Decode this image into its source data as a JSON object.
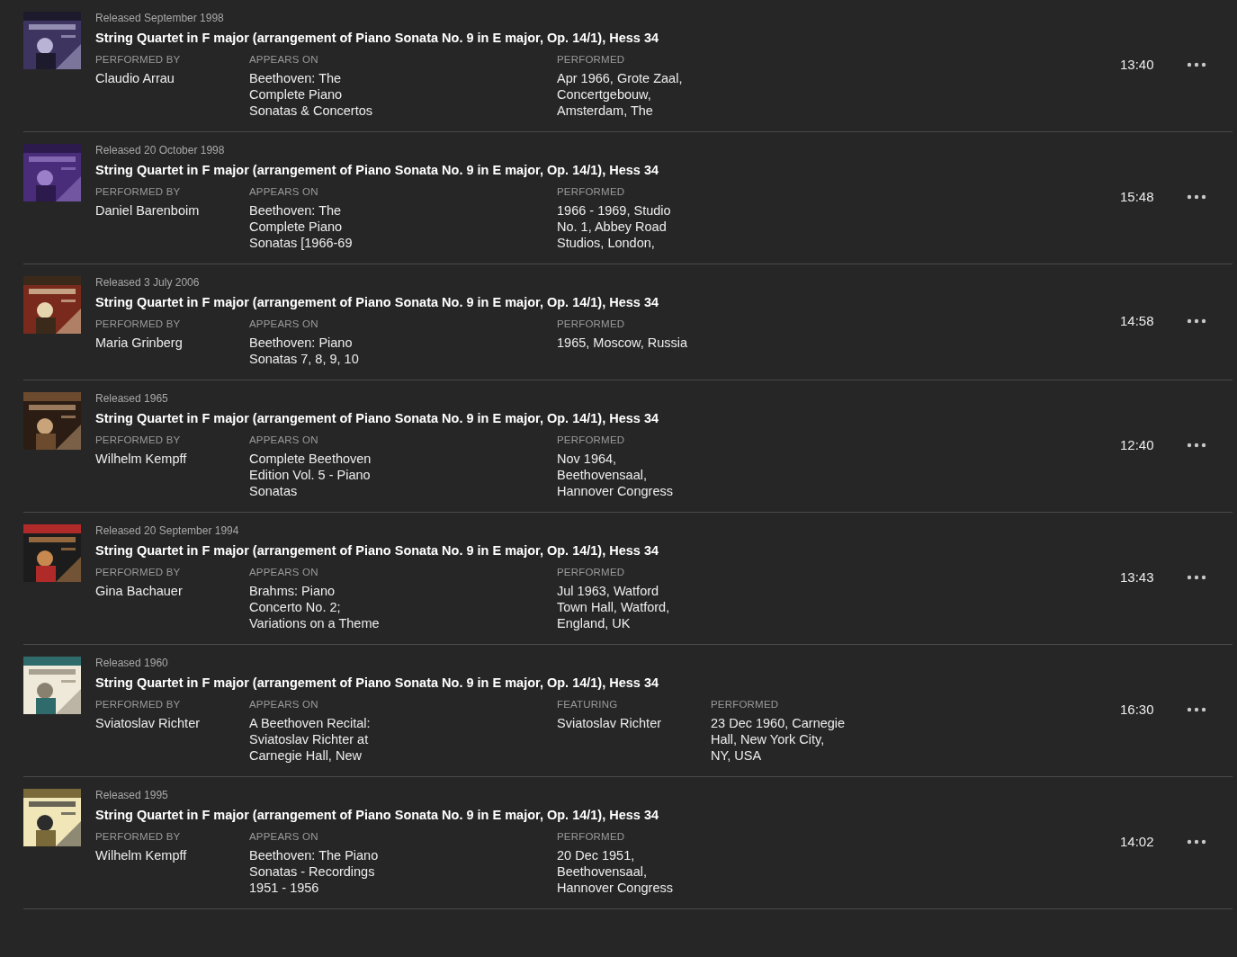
{
  "recordings": [
    {
      "released": "Released September 1998",
      "title": "String Quartet in F major (arrangement of Piano Sonata No. 9 in E major, Op. 14/1), Hess 34",
      "fields": [
        {
          "kind": "performer",
          "label": "PERFORMED BY",
          "value": "Claudio Arrau"
        },
        {
          "kind": "album",
          "label": "APPEARS ON",
          "value": "Beethoven: The Complete Piano Sonatas & Concertos"
        },
        {
          "kind": "performed",
          "label": "PERFORMED",
          "value": "Apr 1966, Grote Zaal, Concertgebouw, Amsterdam, The"
        }
      ],
      "duration": "13:40"
    },
    {
      "released": "Released 20 October 1998",
      "title": "String Quartet in F major (arrangement of Piano Sonata No. 9 in E major, Op. 14/1), Hess 34",
      "fields": [
        {
          "kind": "performer",
          "label": "PERFORMED BY",
          "value": "Daniel Barenboim"
        },
        {
          "kind": "album",
          "label": "APPEARS ON",
          "value": "Beethoven: The Complete Piano Sonatas [1966-69"
        },
        {
          "kind": "performed",
          "label": "PERFORMED",
          "value": "1966 - 1969, Studio No. 1, Abbey Road Studios, London,"
        }
      ],
      "duration": "15:48"
    },
    {
      "released": "Released 3 July 2006",
      "title": "String Quartet in F major (arrangement of Piano Sonata No. 9 in E major, Op. 14/1), Hess 34",
      "fields": [
        {
          "kind": "performer",
          "label": "PERFORMED BY",
          "value": "Maria Grinberg"
        },
        {
          "kind": "album",
          "label": "APPEARS ON",
          "value": "Beethoven: Piano Sonatas 7, 8, 9, 10"
        },
        {
          "kind": "performed",
          "label": "PERFORMED",
          "value": "1965, Moscow, Russia"
        }
      ],
      "duration": "14:58"
    },
    {
      "released": "Released 1965",
      "title": "String Quartet in F major (arrangement of Piano Sonata No. 9 in E major, Op. 14/1), Hess 34",
      "fields": [
        {
          "kind": "performer",
          "label": "PERFORMED BY",
          "value": "Wilhelm Kempff"
        },
        {
          "kind": "album",
          "label": "APPEARS ON",
          "value": "Complete Beethoven Edition Vol. 5 - Piano Sonatas"
        },
        {
          "kind": "performed",
          "label": "PERFORMED",
          "value": "Nov 1964, Beethovensaal, Hannover Congress"
        }
      ],
      "duration": "12:40"
    },
    {
      "released": "Released 20 September 1994",
      "title": "String Quartet in F major (arrangement of Piano Sonata No. 9 in E major, Op. 14/1), Hess 34",
      "fields": [
        {
          "kind": "performer",
          "label": "PERFORMED BY",
          "value": "Gina Bachauer"
        },
        {
          "kind": "album",
          "label": "APPEARS ON",
          "value": "Brahms: Piano Concerto No. 2; Variations on a Theme"
        },
        {
          "kind": "performed",
          "label": "PERFORMED",
          "value": "Jul 1963, Watford Town Hall, Watford, England, UK"
        }
      ],
      "duration": "13:43"
    },
    {
      "released": "Released 1960",
      "title": "String Quartet in F major (arrangement of Piano Sonata No. 9 in E major, Op. 14/1), Hess 34",
      "fields": [
        {
          "kind": "performer",
          "label": "PERFORMED BY",
          "value": "Sviatoslav Richter"
        },
        {
          "kind": "album",
          "label": "APPEARS ON",
          "value": "A Beethoven Recital: Sviatoslav Richter at Carnegie Hall, New"
        },
        {
          "kind": "featuring",
          "label": "FEATURING",
          "value": "Sviatoslav Richter"
        },
        {
          "kind": "performed",
          "label": "PERFORMED",
          "value": "23 Dec 1960, Carnegie Hall, New York City, NY, USA"
        }
      ],
      "duration": "16:30"
    },
    {
      "released": "Released 1995",
      "title": "String Quartet in F major (arrangement of Piano Sonata No. 9 in E major, Op. 14/1), Hess 34",
      "fields": [
        {
          "kind": "performer",
          "label": "PERFORMED BY",
          "value": "Wilhelm Kempff"
        },
        {
          "kind": "album",
          "label": "APPEARS ON",
          "value": "Beethoven: The Piano Sonatas - Recordings 1951 - 1956"
        },
        {
          "kind": "performed",
          "label": "PERFORMED",
          "value": "20 Dec 1951, Beethovensaal, Hannover Congress"
        }
      ],
      "duration": "14:02"
    }
  ]
}
